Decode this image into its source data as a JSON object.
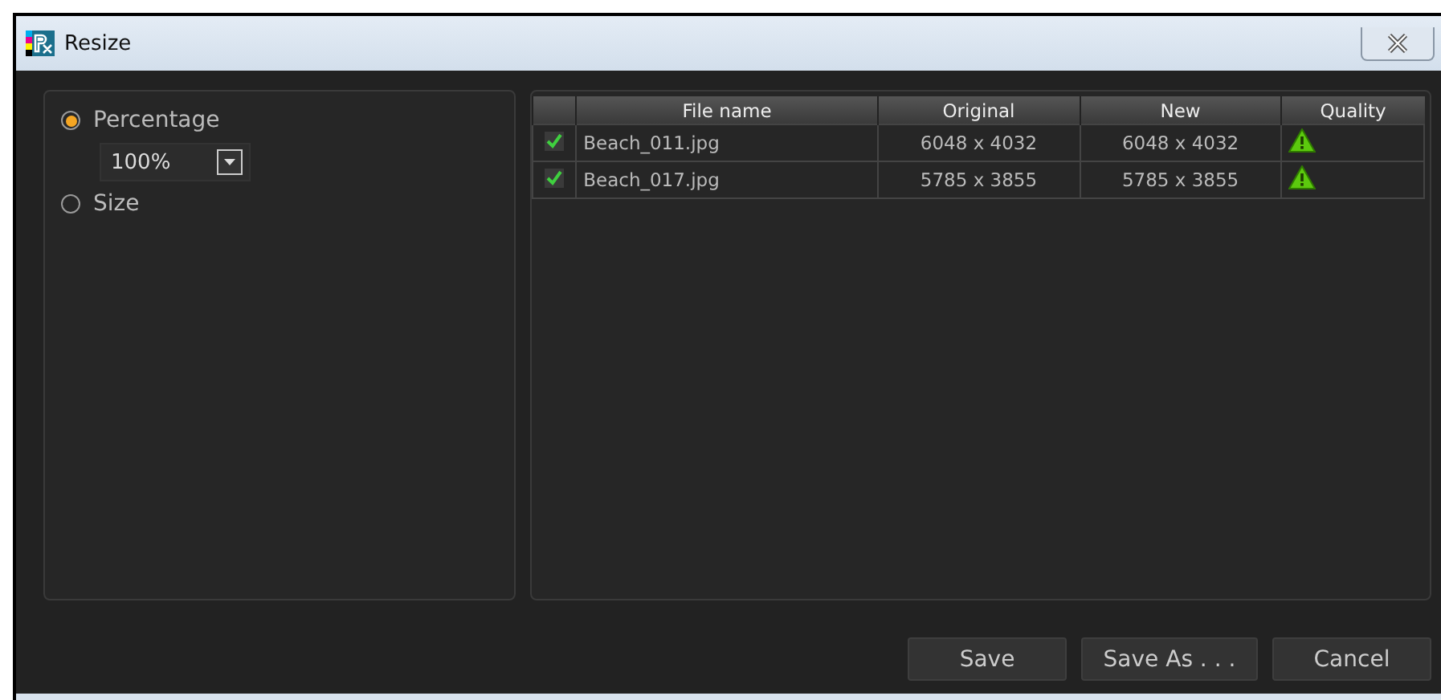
{
  "window": {
    "title": "Resize"
  },
  "options": [
    {
      "label": "Percentage",
      "selected": true
    },
    {
      "label": "Size",
      "selected": false
    }
  ],
  "percentage": {
    "value": "100%"
  },
  "table": {
    "columns": [
      "File name",
      "Original",
      "New",
      "Quality"
    ],
    "rows": [
      {
        "checked": true,
        "file": "Beach_011.jpg",
        "original": "6048 x 4032",
        "new": "6048 x 4032"
      },
      {
        "checked": true,
        "file": "Beach_017.jpg",
        "original": "5785 x 3855",
        "new": "5785 x 3855"
      }
    ]
  },
  "buttons": [
    "Save",
    "Save As . . .",
    "Cancel"
  ]
}
